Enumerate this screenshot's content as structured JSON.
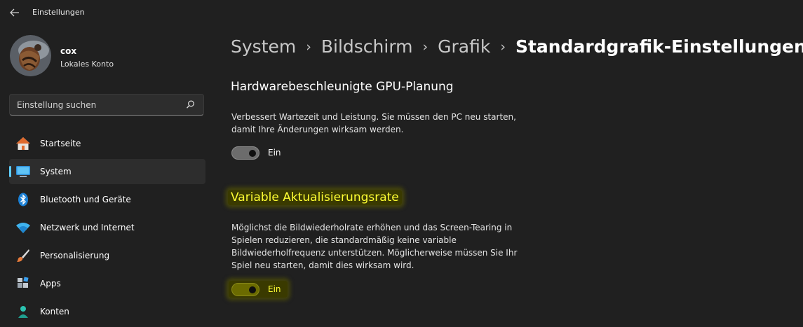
{
  "window": {
    "title": "Einstellungen"
  },
  "user": {
    "name": "cox",
    "account_type": "Lokales Konto"
  },
  "search": {
    "placeholder": "Einstellung suchen"
  },
  "sidebar": {
    "items": [
      {
        "label": "Startseite",
        "icon": "home-icon"
      },
      {
        "label": "System",
        "icon": "system-display-icon",
        "active": true
      },
      {
        "label": "Bluetooth und Geräte",
        "icon": "bluetooth-icon"
      },
      {
        "label": "Netzwerk und Internet",
        "icon": "wifi-icon"
      },
      {
        "label": "Personalisierung",
        "icon": "paintbrush-icon"
      },
      {
        "label": "Apps",
        "icon": "apps-icon"
      },
      {
        "label": "Konten",
        "icon": "person-icon"
      }
    ]
  },
  "breadcrumb": {
    "items": [
      "System",
      "Bildschirm",
      "Grafik"
    ],
    "separator": "›",
    "current": "Standardgrafik-Einstellungen"
  },
  "settings": {
    "gpu": {
      "title": "Hardwarebeschleunigte GPU-Planung",
      "description_lines": [
        "Verbessert Wartezeit und Leistung. Sie müssen den PC neu starten,",
        "damit Ihre Änderungen wirksam werden."
      ],
      "toggle_label": "Ein",
      "toggle_on": true
    },
    "vrr": {
      "title": "Variable Aktualisierungsrate",
      "description_lines": [
        "Möglichst die Bildwiederholrate erhöhen und das Screen-Tearing in",
        "Spielen reduzieren, die standardmäßig keine variable",
        "Bildwiederholfrequenz unterstützen. Möglicherweise müssen Sie Ihr",
        "Spiel neu starten, damit dies wirksam wird."
      ],
      "toggle_label": "Ein",
      "toggle_on": true,
      "highlighted": true
    }
  },
  "colors": {
    "background": "#202020",
    "accent": "#60cdff",
    "highlight_text": "#ffff33",
    "highlight_bg": "#3a3a00"
  }
}
